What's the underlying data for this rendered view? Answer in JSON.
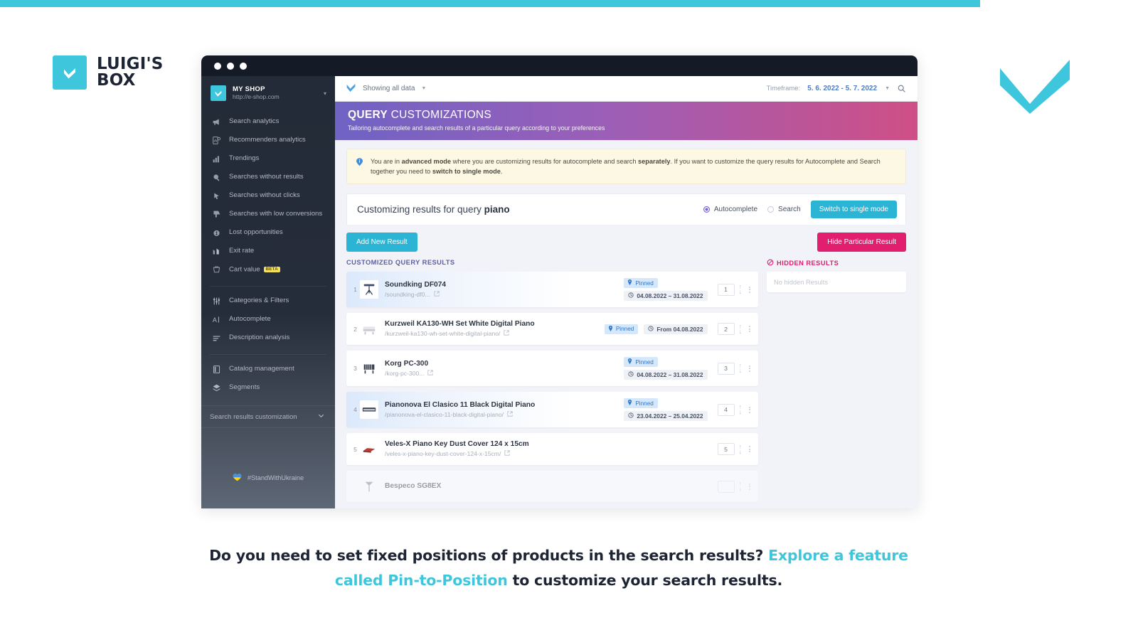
{
  "brand": {
    "logo_line1": "LUIGI'S",
    "logo_line2": "BOX",
    "accent_color": "#3ec6dd"
  },
  "window": {
    "titlebar_dots": 3
  },
  "sidebar": {
    "shop": {
      "name": "MY SHOP",
      "url": "http://e-shop.com",
      "caret_icon": "chevron-down-icon"
    },
    "group1": [
      {
        "label": "Search analytics",
        "icon": "megaphone-icon"
      },
      {
        "label": "Recommenders analytics",
        "icon": "document-chart-icon"
      },
      {
        "label": "Trendings",
        "icon": "bar-chart-icon"
      },
      {
        "label": "Searches without results",
        "icon": "magnifier-icon"
      },
      {
        "label": "Searches without clicks",
        "icon": "cursor-click-icon"
      },
      {
        "label": "Searches with low conversions",
        "icon": "thumbs-down-icon"
      },
      {
        "label": "Lost opportunities",
        "icon": "coin-icon"
      },
      {
        "label": "Exit rate",
        "icon": "arrow-chart-icon"
      },
      {
        "label": "Cart value",
        "icon": "cart-icon",
        "badge": "BETA"
      }
    ],
    "group2": [
      {
        "label": "Categories & Filters",
        "icon": "sliders-icon"
      },
      {
        "label": "Autocomplete",
        "icon": "text-cursor-icon"
      },
      {
        "label": "Description analysis",
        "icon": "lines-icon"
      }
    ],
    "group3": [
      {
        "label": "Catalog management",
        "icon": "book-icon"
      },
      {
        "label": "Segments",
        "icon": "layers-icon"
      }
    ],
    "expandable": {
      "label": "Search results customization",
      "icon": "chevron-down-icon"
    },
    "footer": {
      "label": "#StandWithUkraine",
      "icon": "ukraine-heart-icon"
    }
  },
  "topbar": {
    "data_scope_label": "Showing all data",
    "data_scope_icon": "luigi-chevron-icon",
    "caret_icon": "caret-down-icon",
    "timeframe_label": "Timeframe:",
    "timeframe_value": "5. 6. 2022 - 5. 7. 2022",
    "search_icon": "search-icon"
  },
  "header": {
    "title_bold": "QUERY",
    "title_rest": "CUSTOMIZATIONS",
    "subtitle": "Tailoring autocomplete and search results of a particular query according to your preferences"
  },
  "notice": {
    "icon": "info-icon",
    "part1": "You are in ",
    "bold1": "advanced mode",
    "part2": " where you are customizing results for autocomplete and search ",
    "bold2": "separately",
    "part3": ". If you want to customize the query results for Autocomplete and Search together you need to ",
    "bold3": "switch to single mode",
    "part4": "."
  },
  "customizing": {
    "title_prefix": "Customizing results for query ",
    "title_query": "piano",
    "radio_autocomplete": "Autocomplete",
    "radio_search": "Search",
    "selected": "Autocomplete",
    "switch_button": "Switch to single mode"
  },
  "actions": {
    "add_new_result": "Add New Result",
    "hide_particular_result": "Hide Particular Result",
    "customized_heading": "CUSTOMIZED QUERY RESULTS",
    "hidden_heading": "HIDDEN RESULTS",
    "hidden_heading_icon": "no-entry-icon",
    "hidden_empty": "No hidden Results"
  },
  "results": [
    {
      "index": "1",
      "title": "Soundking DF074",
      "url": "/soundking-df0...",
      "thumb_icon": "music-stand-icon",
      "pinned_label": "Pinned",
      "pin_icon": "pin-icon",
      "date_label": "04.08.2022 – 31.08.2022",
      "date_icon": "clock-icon",
      "position": "1",
      "layout": "stacked",
      "highlighted": true
    },
    {
      "index": "2",
      "title": "Kurzweil KA130-WH Set White Digital Piano",
      "url": "/kurzweil-ka130-wh-set-white-digital-piano/",
      "thumb_icon": "piano-white-icon",
      "pinned_label": "Pinned",
      "pin_icon": "pin-icon",
      "date_label": "From 04.08.2022",
      "date_icon": "clock-icon",
      "position": "2",
      "layout": "inline",
      "highlighted": false
    },
    {
      "index": "3",
      "title": "Korg PC-300",
      "url": "/korg-pc-300...",
      "thumb_icon": "piano-dark-icon",
      "pinned_label": "Pinned",
      "pin_icon": "pin-icon",
      "date_label": "04.08.2022 – 31.08.2022",
      "date_icon": "clock-icon",
      "position": "3",
      "layout": "stacked",
      "highlighted": false
    },
    {
      "index": "4",
      "title": "Pianonova El Clasico 11 Black Digital Piano",
      "url": "/pianonova-el-clasico-11-black-digital-piano/",
      "thumb_icon": "keyboard-icon",
      "pinned_label": "Pinned",
      "pin_icon": "pin-icon",
      "date_label": "23.04.2022 – 25.04.2022",
      "date_icon": "clock-icon",
      "position": "4",
      "layout": "stacked",
      "highlighted": true
    },
    {
      "index": "5",
      "title": "Veles-X Piano Key Dust Cover 124 x 15cm",
      "url": "/veles-x-piano-key-dust-cover-124-x-15cm/",
      "thumb_icon": "dust-cover-icon",
      "pinned_label": "",
      "pin_icon": "",
      "date_label": "",
      "date_icon": "",
      "position": "5",
      "layout": "none",
      "highlighted": false
    },
    {
      "index": "",
      "title": "Bespeco SG8EX",
      "url": "",
      "thumb_icon": "mic-stand-icon",
      "pinned_label": "",
      "pin_icon": "",
      "date_label": "",
      "date_icon": "",
      "position": "",
      "layout": "none",
      "highlighted": false
    }
  ],
  "caption": {
    "part1": "Do you need to set fixed positions of products in the search results? ",
    "highlight1": "Explore a feature called Pin-to-Position",
    "part2": " to customize your search results."
  },
  "colors": {
    "teal": "#3ec6dd",
    "pink": "#e21e6e",
    "purple": "#7a5cd6",
    "blue_tag": "#2f77c9",
    "sidebar_dark": "#242b38"
  }
}
